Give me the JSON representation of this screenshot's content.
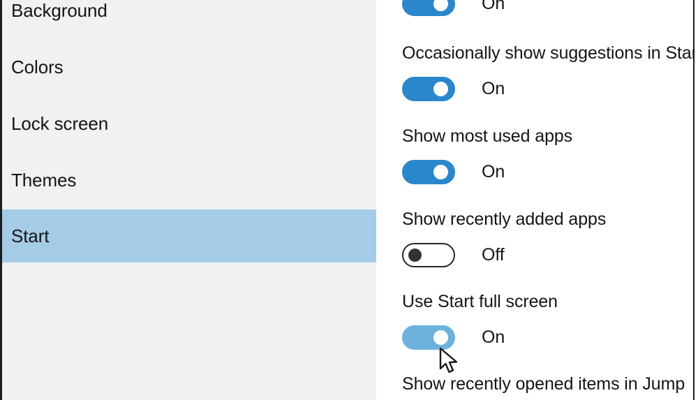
{
  "colors": {
    "sidebar_bg": "#f1f1f1",
    "panel_bg": "#ffffff",
    "selection": "#a5cce7",
    "accent": "#2b87cc",
    "accent_hover": "#6cb2dd",
    "text": "#151515",
    "toggle_off_border": "#262626",
    "frame_line": "#1d1d1d"
  },
  "sidebar": {
    "items": [
      {
        "label": "Background",
        "selected": false
      },
      {
        "label": "Colors",
        "selected": false
      },
      {
        "label": "Lock screen",
        "selected": false
      },
      {
        "label": "Themes",
        "selected": false
      },
      {
        "label": "Start",
        "selected": true
      }
    ]
  },
  "panel": {
    "settings": [
      {
        "label": "",
        "state": "On",
        "toggle": "on",
        "label_visible": false
      },
      {
        "label": "Occasionally show suggestions in Star",
        "state": "On",
        "toggle": "on",
        "label_visible": true
      },
      {
        "label": "Show most used apps",
        "state": "On",
        "toggle": "on",
        "label_visible": true
      },
      {
        "label": "Show recently added apps",
        "state": "Off",
        "toggle": "off",
        "label_visible": true
      },
      {
        "label": "Use Start full screen",
        "state": "On",
        "toggle": "on-hover",
        "label_visible": true
      },
      {
        "label": "Show recently opened items in Jump",
        "state": "",
        "toggle": "",
        "label_visible": true
      }
    ]
  },
  "cursor": {
    "icon": "arrow-pointer-cursor"
  }
}
